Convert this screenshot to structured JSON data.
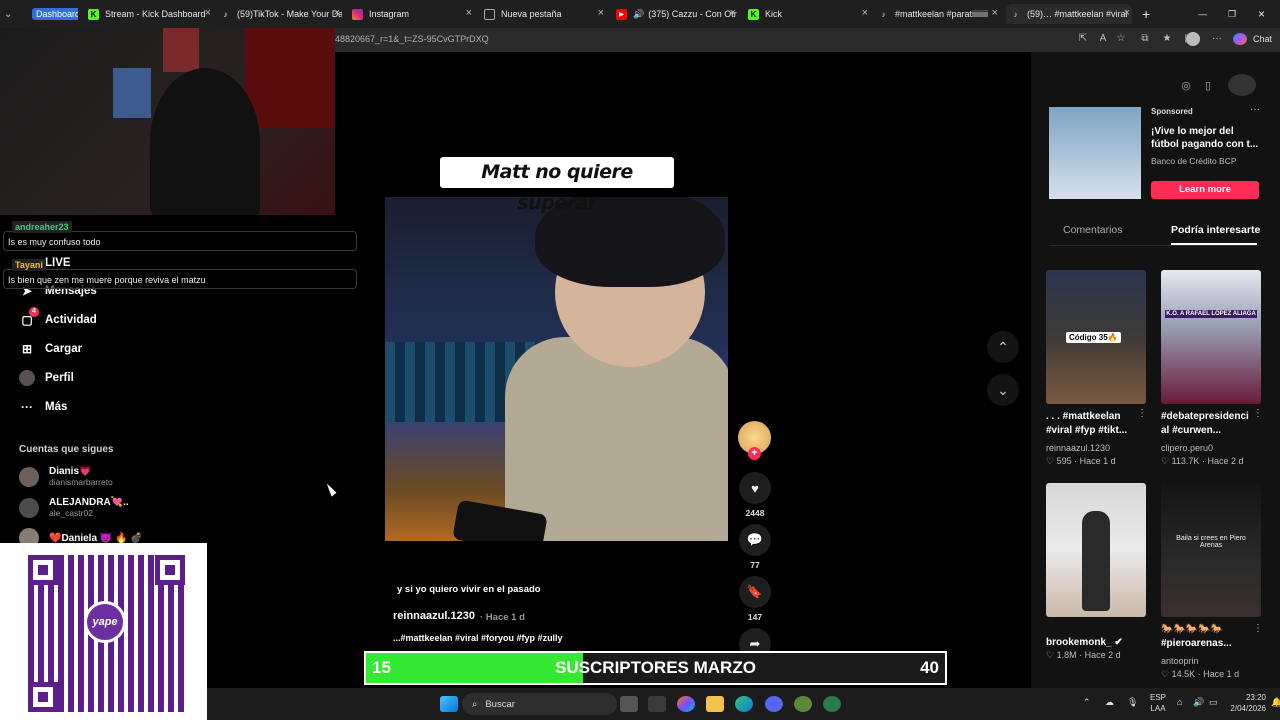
{
  "browser": {
    "tabs": [
      {
        "label": "Dashboard",
        "icon": "kick-icon"
      },
      {
        "label": "Stream - Kick Dashboard",
        "icon": "kick-icon"
      },
      {
        "label": "(59)TikTok - Make Your Da",
        "icon": "tiktok-icon"
      },
      {
        "label": "Instagram",
        "icon": "instagram-icon"
      },
      {
        "label": "Nueva pestaña",
        "icon": "newtab-icon"
      },
      {
        "label": "(375) Cazzu - Con Otr",
        "icon": "youtube-icon"
      },
      {
        "label": "Kick",
        "icon": "kick-icon"
      },
      {
        "label": "#mattkeelan #paratiiiiiiii",
        "icon": "tiktok-icon"
      },
      {
        "label": "(59)… #mattkeelan #viral",
        "icon": "tiktok-icon"
      }
    ],
    "url": "48820667_r=1&_t=ZS-95CvGTPrDXQ",
    "chat_label": "Chat"
  },
  "chat_overlay": [
    {
      "user": "andreaher23",
      "user_color": "#33d17a",
      "text": "Is es muy confuso todo"
    },
    {
      "user": "Tayani",
      "user_color": "#f5c211",
      "text": "Is bien que zen me muere porque reviva el matzu"
    }
  ],
  "sidebar": {
    "live_label": "LIVE",
    "items": [
      {
        "label": "Mensajes",
        "icon": "send-icon"
      },
      {
        "label": "Actividad",
        "icon": "inbox-icon",
        "badge": "4"
      },
      {
        "label": "Cargar",
        "icon": "upload-icon"
      },
      {
        "label": "Perfil",
        "icon": "profile-icon"
      },
      {
        "label": "Más",
        "icon": "more-icon"
      }
    ],
    "following_title": "Cuentas que sigues",
    "accounts": [
      {
        "name": "Dianis💗",
        "handle": "dianismarbarreto"
      },
      {
        "name": "ALEJANDRA💘..",
        "handle": "ale_castr02"
      },
      {
        "name": "❤️Daniela 👿 🔥 💣",
        "handle": ""
      }
    ]
  },
  "qr": {
    "brand": "yape"
  },
  "video": {
    "caption_overlay": "Matt no quiere superar",
    "description": "y si yo quiero vivir en el pasado",
    "author": "reinnaazul.1230",
    "time": "· Hace 1 d",
    "tags": "...#mattkeelan #viral #foryou #fyp #zully",
    "likes": "2448",
    "comments": "77",
    "saves": "147"
  },
  "right_panel": {
    "ad": {
      "sponsored": "Sponsored",
      "title": "¡Vive lo mejor del fútbol pagando con t...",
      "advertiser": "Banco de Crédito BCP",
      "cta": "Learn more"
    },
    "tabs": [
      "Comentarios",
      "Podría interesarte"
    ],
    "cards": [
      {
        "title": ". . . #mattkeelan #viral #fyp #tikt...",
        "author": "reinnaazul.1230",
        "likes": "595",
        "time": "· Hace 1 d",
        "thumb_text": "Código 35🔥"
      },
      {
        "title": "#debatepresidenci al #curwen...",
        "author": "clipero.peru0",
        "likes": "113.7K",
        "time": "· Hace 2 d",
        "thumb_text": "K.O. A RAFAEL LÓPEZ ALIAGA"
      },
      {
        "title": "brookemonk_ ✔",
        "author": "",
        "likes": "1.8M",
        "time": "· Hace 2 d",
        "thumb_text": ""
      },
      {
        "title": "🐎🐎🐎🐎🐎 #pieroarenas...",
        "author": "antooprin",
        "likes": "14.5K",
        "time": "· Hace 1 d",
        "thumb_text": "Baila si crees en Piero Arenas"
      }
    ]
  },
  "subscriber_goal": {
    "current": "15",
    "label": "SUSCRIPTORES MARZO",
    "goal": "40",
    "progress": 0.375,
    "color": "#35e834"
  },
  "taskbar": {
    "search": "Buscar",
    "lang_top": "ESP",
    "lang_bottom": "LAA",
    "time": "23:20",
    "date": "2/04/2026"
  }
}
